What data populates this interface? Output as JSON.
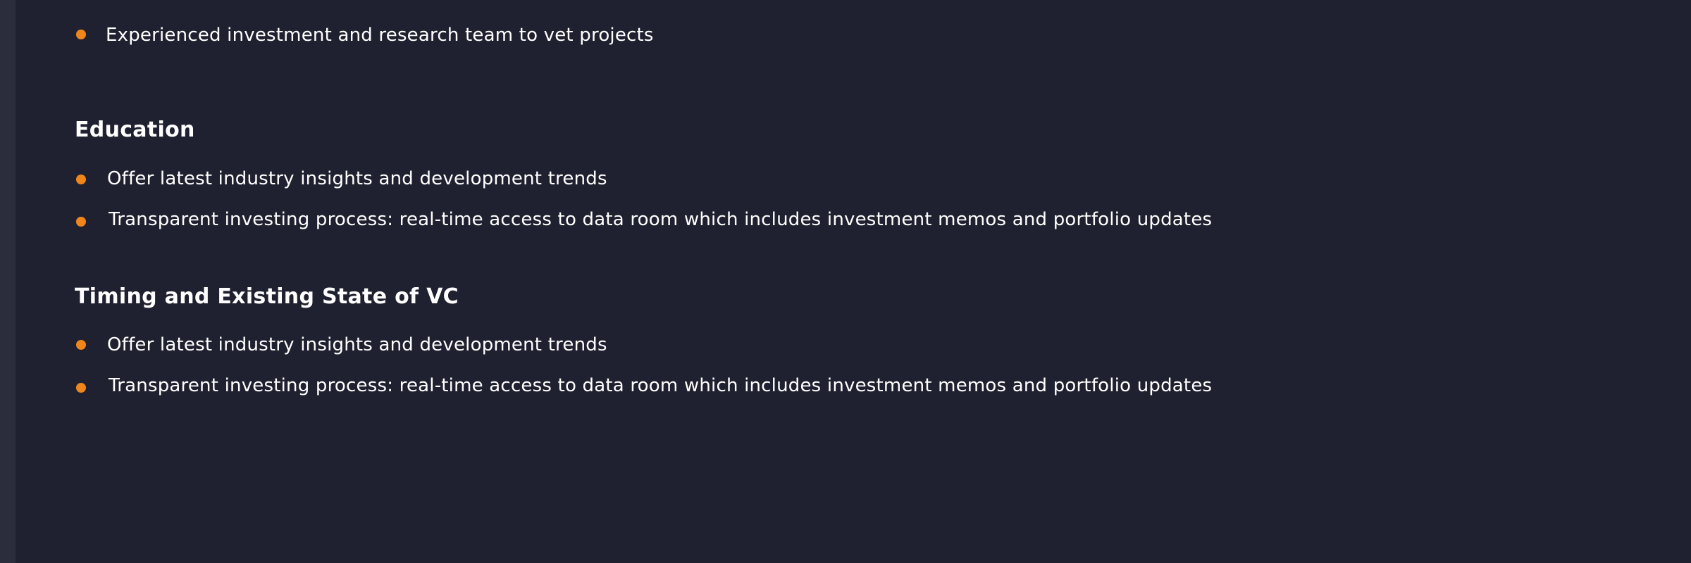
{
  "sections": [
    {
      "heading": "",
      "items": [
        "Experienced investment and research team to vet projects"
      ]
    },
    {
      "heading": "Education",
      "items": [
        "Offer latest industry insights and development trends",
        "Transparent investing process: real-time access to data room which includes investment memos and portfolio updates"
      ]
    },
    {
      "heading": "Timing and Existing State of VC",
      "items": [
        "Offer latest industry insights and development trends",
        "Transparent investing process: real-time access to data room which includes investment memos and portfolio updates"
      ]
    }
  ],
  "colors": {
    "background": "#202130",
    "bullet": "#f0861b",
    "left_strip": "#2b2d3d",
    "text": "#ffffff"
  }
}
